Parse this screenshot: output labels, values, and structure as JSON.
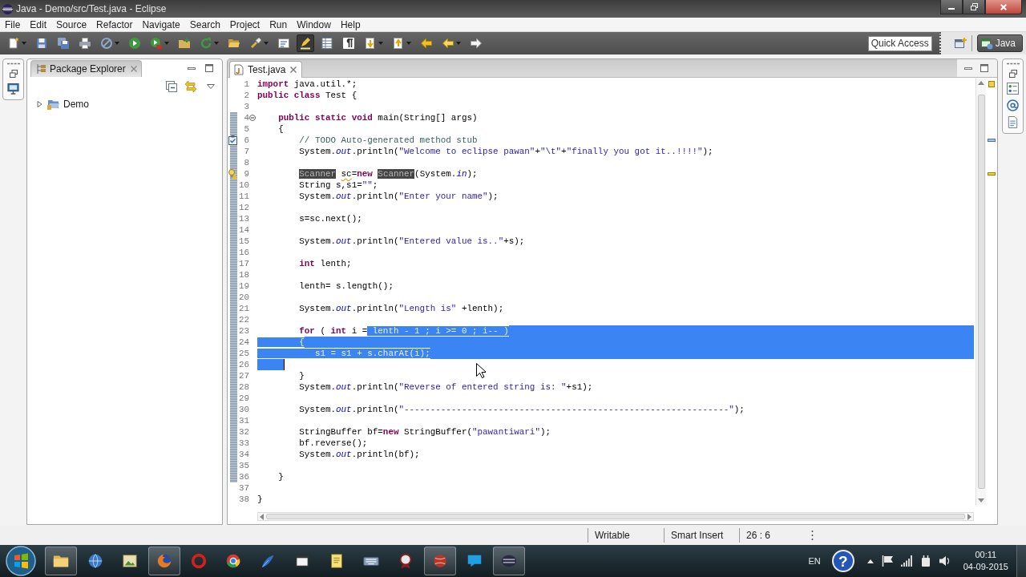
{
  "window": {
    "title": "Java - Demo/src/Test.java - Eclipse"
  },
  "menu": [
    "File",
    "Edit",
    "Source",
    "Refactor",
    "Navigate",
    "Search",
    "Project",
    "Run",
    "Window",
    "Help"
  ],
  "toolbar": [
    {
      "kind": "new",
      "dropdown": true,
      "pressed": false
    },
    {
      "kind": "save",
      "dropdown": false,
      "pressed": false
    },
    {
      "kind": "save-all",
      "dropdown": false,
      "pressed": false
    },
    {
      "kind": "print",
      "dropdown": false,
      "pressed": false
    },
    {
      "kind": "target",
      "dropdown": true,
      "pressed": false
    },
    {
      "kind": "run",
      "dropdown": false,
      "pressed": false
    },
    {
      "kind": "external",
      "dropdown": true,
      "pressed": false
    },
    {
      "kind": "project",
      "dropdown": false,
      "pressed": false
    },
    {
      "kind": "refresh",
      "dropdown": true,
      "pressed": false
    },
    {
      "kind": "open",
      "dropdown": false,
      "pressed": false
    },
    {
      "kind": "search",
      "dropdown": true,
      "pressed": false
    },
    {
      "kind": "template",
      "dropdown": false,
      "pressed": false
    },
    {
      "kind": "highlight",
      "dropdown": false,
      "pressed": true
    },
    {
      "kind": "table",
      "dropdown": false,
      "pressed": false
    },
    {
      "kind": "paragraph",
      "dropdown": false,
      "pressed": false
    },
    {
      "kind": "next",
      "dropdown": true,
      "pressed": false
    },
    {
      "kind": "prev",
      "dropdown": true,
      "pressed": false
    },
    {
      "kind": "back",
      "dropdown": false,
      "pressed": false
    },
    {
      "kind": "left",
      "dropdown": true,
      "pressed": false
    },
    {
      "kind": "forward",
      "dropdown": false,
      "pressed": false
    }
  ],
  "quick_access": {
    "placeholder": "Quick Access"
  },
  "perspectives": [
    {
      "label": "Java",
      "selected": true
    }
  ],
  "package_explorer": {
    "title": "Package Explorer",
    "active": false,
    "tree": [
      {
        "label": "Demo",
        "expanded": false
      }
    ]
  },
  "editor": {
    "tabs": [
      {
        "title": "Test.java",
        "selected": true
      }
    ],
    "lines": [
      {
        "number": "1",
        "tokens": [
          {
            "text": "import",
            "kind": "keyword"
          },
          {
            "text": " java.util.*;",
            "kind": "plain"
          }
        ]
      },
      {
        "number": "2",
        "tokens": [
          {
            "text": "public",
            "kind": "keyword"
          },
          {
            "text": " class",
            "kind": "keyword"
          },
          {
            "text": " Test {",
            "kind": "plain"
          }
        ]
      },
      {
        "number": "3"
      },
      {
        "number": "4",
        "tokens": [
          {
            "text": "    public",
            "kind": "keyword"
          },
          {
            "text": " static",
            "kind": "keyword"
          },
          {
            "text": " void",
            "kind": "keyword"
          },
          {
            "text": " main(String[] args)",
            "kind": "plain"
          }
        ],
        "expanded": true,
        "ranged": true,
        "children": [
          {
            "number": "5",
            "tokens": [
              {
                "text": "    {",
                "kind": "plain"
              }
            ]
          },
          {
            "number": "6",
            "tokens": [
              {
                "text": "        // TODO Auto-generated method stub",
                "kind": "comment"
              }
            ],
            "marker": {
              "kind": "task"
            }
          },
          {
            "number": "7",
            "tokens": [
              {
                "text": "        System.",
                "kind": "plain"
              },
              {
                "text": "out",
                "kind": "field"
              },
              {
                "text": ".println(",
                "kind": "plain"
              },
              {
                "text": "\"Welcome to eclipse pawan\"",
                "kind": "string"
              },
              {
                "text": "+",
                "kind": "plain"
              },
              {
                "text": "\"\\t\"",
                "kind": "string"
              },
              {
                "text": "+",
                "kind": "plain"
              },
              {
                "text": "\"finally you got it..!!!!\"",
                "kind": "string"
              },
              {
                "text": ");",
                "kind": "plain"
              }
            ]
          },
          {
            "number": "8"
          },
          {
            "number": "9",
            "tokens": [
              {
                "text": "        Scanner",
                "kind": "occurrence"
              },
              {
                "text": " sc",
                "kind": "warning"
              },
              {
                "text": "=",
                "kind": "plain"
              },
              {
                "text": "new",
                "kind": "keyword"
              },
              {
                "text": " Scanner",
                "kind": "occurrence"
              },
              {
                "text": "(System.",
                "kind": "plain"
              },
              {
                "text": "in",
                "kind": "field"
              },
              {
                "text": ");",
                "kind": "plain"
              }
            ],
            "marker": {
              "kind": "warning"
            }
          },
          {
            "number": "10",
            "tokens": [
              {
                "text": "        String s,s1=",
                "kind": "plain"
              },
              {
                "text": "\"\"",
                "kind": "string"
              },
              {
                "text": ";",
                "kind": "plain"
              }
            ]
          },
          {
            "number": "11",
            "tokens": [
              {
                "text": "        System.",
                "kind": "plain"
              },
              {
                "text": "out",
                "kind": "field"
              },
              {
                "text": ".println(",
                "kind": "plain"
              },
              {
                "text": "\"Enter your name\"",
                "kind": "string"
              },
              {
                "text": ");",
                "kind": "plain"
              }
            ]
          },
          {
            "number": "12"
          },
          {
            "number": "13",
            "tokens": [
              {
                "text": "        s=sc.next();",
                "kind": "plain"
              }
            ]
          },
          {
            "number": "14"
          },
          {
            "number": "15",
            "tokens": [
              {
                "text": "        System.",
                "kind": "plain"
              },
              {
                "text": "out",
                "kind": "field"
              },
              {
                "text": ".println(",
                "kind": "plain"
              },
              {
                "text": "\"Entered value is..\"",
                "kind": "string"
              },
              {
                "text": "+s);",
                "kind": "plain"
              }
            ]
          },
          {
            "number": "16"
          },
          {
            "number": "17",
            "tokens": [
              {
                "text": "        int",
                "kind": "keyword"
              },
              {
                "text": " lenth;",
                "kind": "plain"
              }
            ]
          },
          {
            "number": "18"
          },
          {
            "number": "19",
            "tokens": [
              {
                "text": "        lenth= s.length();",
                "kind": "plain"
              }
            ]
          },
          {
            "number": "20"
          },
          {
            "number": "21",
            "tokens": [
              {
                "text": "        System.",
                "kind": "plain"
              },
              {
                "text": "out",
                "kind": "field"
              },
              {
                "text": ".println(",
                "kind": "plain"
              },
              {
                "text": "\"Length is\"",
                "kind": "string"
              },
              {
                "text": " +lenth);",
                "kind": "plain"
              }
            ]
          },
          {
            "number": "22"
          },
          {
            "number": "23",
            "tokens": [
              {
                "text": "        for",
                "kind": "keyword"
              },
              {
                "text": " ( ",
                "kind": "plain"
              },
              {
                "text": "int",
                "kind": "keyword"
              },
              {
                "text": " i =",
                "kind": "plain"
              },
              {
                "text": " lenth - 1 ; i >= 0 ; i-- )",
                "kind": "selected"
              }
            ],
            "selected_to_end": true
          },
          {
            "number": "24",
            "tokens": [
              {
                "text": "        {",
                "kind": "selected"
              }
            ],
            "selected_to_end": true
          },
          {
            "number": "25",
            "tokens": [
              {
                "text": "           s1 = s1 + s.charAt(i);",
                "kind": "selected"
              }
            ],
            "selected_to_end": true
          },
          {
            "number": "26",
            "selected_indent": true,
            "caret": true
          },
          {
            "number": "27",
            "tokens": [
              {
                "text": "        }",
                "kind": "plain"
              }
            ]
          },
          {
            "number": "28",
            "tokens": [
              {
                "text": "        System.",
                "kind": "plain"
              },
              {
                "text": "out",
                "kind": "field"
              },
              {
                "text": ".println(",
                "kind": "plain"
              },
              {
                "text": "\"Reverse of entered string is: \"",
                "kind": "string"
              },
              {
                "text": "+s1);",
                "kind": "plain"
              }
            ]
          },
          {
            "number": "29"
          },
          {
            "number": "30",
            "tokens": [
              {
                "text": "        System.",
                "kind": "plain"
              },
              {
                "text": "out",
                "kind": "field"
              },
              {
                "text": ".println(",
                "kind": "plain"
              },
              {
                "text": "\"--------------------------------------------------------------\"",
                "kind": "string"
              },
              {
                "text": ");",
                "kind": "plain"
              }
            ]
          },
          {
            "number": "31"
          },
          {
            "number": "32",
            "tokens": [
              {
                "text": "        StringBuffer bf=",
                "kind": "plain"
              },
              {
                "text": "new",
                "kind": "keyword"
              },
              {
                "text": " StringBuffer(",
                "kind": "plain"
              },
              {
                "text": "\"pawantiwari\"",
                "kind": "string"
              },
              {
                "text": ");",
                "kind": "plain"
              }
            ]
          },
          {
            "number": "33",
            "tokens": [
              {
                "text": "        bf.reverse();",
                "kind": "plain"
              }
            ]
          },
          {
            "number": "34",
            "tokens": [
              {
                "text": "        System.",
                "kind": "plain"
              },
              {
                "text": "out",
                "kind": "field"
              },
              {
                "text": ".println(bf);",
                "kind": "plain"
              }
            ]
          },
          {
            "number": "35"
          },
          {
            "number": "36",
            "tokens": [
              {
                "text": "    }",
                "kind": "plain"
              }
            ]
          }
        ]
      },
      {
        "number": "37"
      },
      {
        "number": "38",
        "tokens": [
          {
            "text": "}",
            "kind": "plain"
          }
        ]
      }
    ]
  },
  "status_bar": {
    "fields": [
      "Writable",
      "Smart Insert",
      "26 : 6"
    ]
  },
  "taskbar": {
    "apps": [
      {
        "kind": "folder",
        "running": true
      },
      {
        "kind": "globe",
        "running": false
      },
      {
        "kind": "picture",
        "running": false
      },
      {
        "kind": "orb",
        "running": true
      },
      {
        "kind": "ring",
        "running": false
      },
      {
        "kind": "wheel",
        "running": false
      },
      {
        "kind": "feather",
        "running": false
      },
      {
        "kind": "window",
        "running": false
      },
      {
        "kind": "notepad",
        "running": false
      },
      {
        "kind": "keyboard",
        "running": false
      },
      {
        "kind": "badge",
        "running": false
      },
      {
        "kind": "ball",
        "running": true
      },
      {
        "kind": "bubble",
        "running": false
      },
      {
        "kind": "disc",
        "running": true
      }
    ],
    "language": "EN",
    "help": "?",
    "time": "00:11",
    "date": "04-09-2015"
  }
}
